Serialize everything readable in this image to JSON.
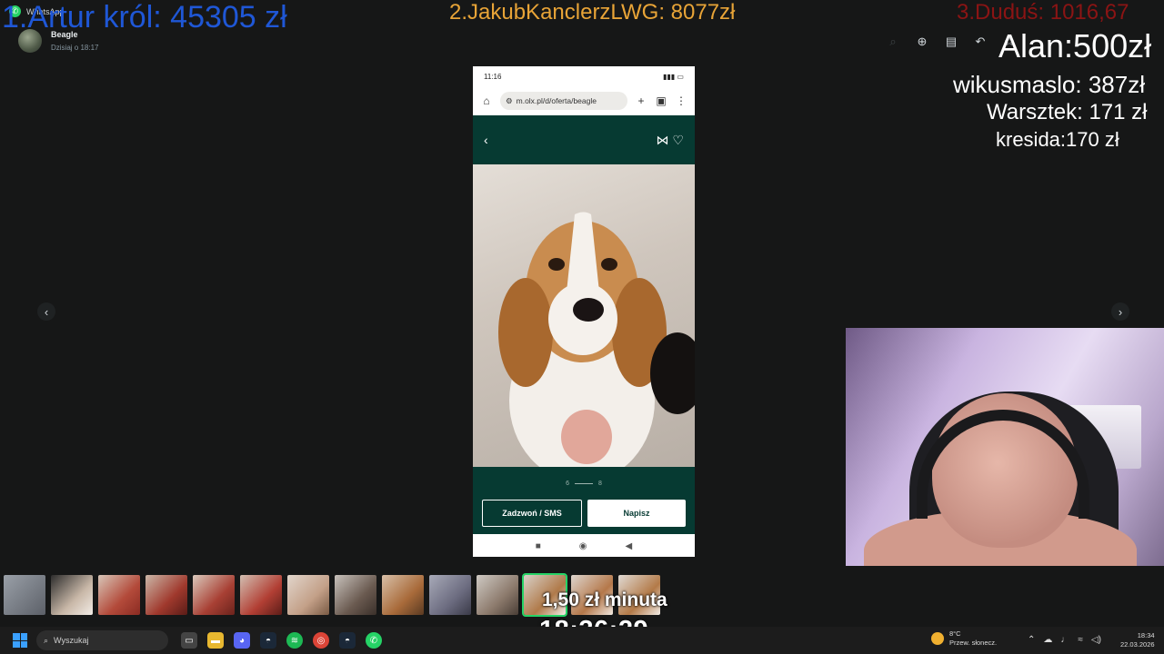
{
  "window": {
    "app_title": "WhatsApp"
  },
  "sender": {
    "name": "Beagle",
    "time": "Dzisiaj o 18:17"
  },
  "phone": {
    "status_time": "11:16",
    "url": "m.olx.pl/d/oferta/beagle",
    "pagination": {
      "current": "6",
      "total": "8"
    },
    "call_button": "Zadzwoń / SMS",
    "write_button": "Napisz"
  },
  "overlay": {
    "donors": [
      "1.Artur król: 45305 zł",
      "2.JakubKanclerzLWG: 8077zł",
      "3.Duduś: 1016,67",
      "Alan:500zł",
      "wikusmaslo: 387zł",
      "Warsztek: 171 zł",
      "kresida:170 zł"
    ],
    "price_per_minute": "1,50 zł minuta",
    "stream_clock": "18:36:29"
  },
  "taskbar": {
    "search_placeholder": "Wyszukaj",
    "weather_temp": "8°C",
    "weather_desc": "Przew. słonecz.",
    "time": "18:34",
    "date": "22.03.2026"
  },
  "colors": {
    "olx_green": "#063a32",
    "whatsapp_green": "#25d366"
  }
}
